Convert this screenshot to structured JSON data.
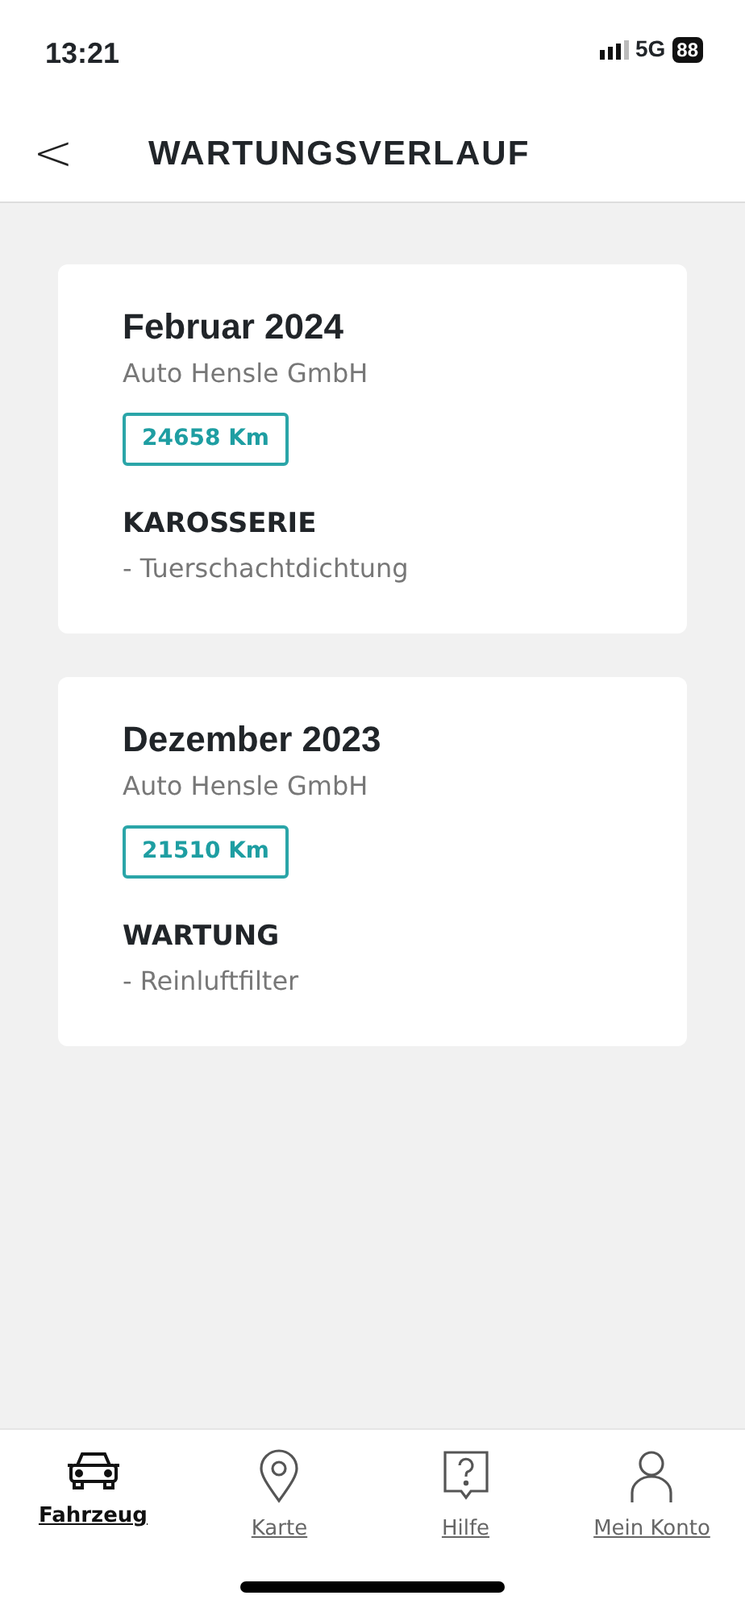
{
  "status_bar": {
    "time": "13:21",
    "network": "5G",
    "battery": "88"
  },
  "header": {
    "back": "<",
    "title": "WARTUNGSVERLAUF"
  },
  "entries": [
    {
      "date": "Februar 2024",
      "workshop": "Auto Hensle GmbH",
      "mileage": "24658 Km",
      "category": "KAROSSERIE",
      "item": "- Tuerschachtdichtung"
    },
    {
      "date": "Dezember 2023",
      "workshop": "Auto Hensle GmbH",
      "mileage": "21510 Km",
      "category": "WARTUNG",
      "item": "- Reinluftfilter"
    }
  ],
  "tabs": [
    {
      "kind": "car",
      "label": "Fahrzeug",
      "selected": true
    },
    {
      "kind": "pin",
      "label": "Karte",
      "selected": false
    },
    {
      "kind": "help",
      "label": "Hilfe",
      "selected": false
    },
    {
      "kind": "person",
      "label": "Mein Konto",
      "selected": false
    }
  ]
}
